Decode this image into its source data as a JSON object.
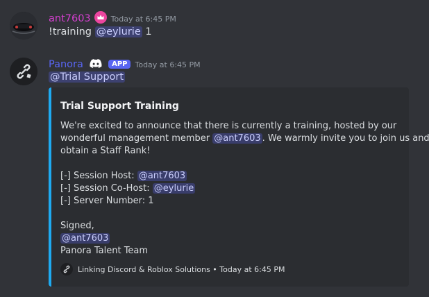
{
  "messages": [
    {
      "author": "ant7603",
      "author_color": "#d43fcf",
      "timestamp": "Today at 6:45 PM",
      "badge_icon": "crown-icon",
      "content": {
        "prefix": "!training ",
        "mention": "@eylurie",
        "suffix": " 1"
      }
    },
    {
      "author": "Panora",
      "author_color": "#5865f2",
      "app_tag": "APP",
      "badge_icon": "discord-icon",
      "timestamp": "Today at 6:45 PM",
      "mention_line": "@Trial Support",
      "embed": {
        "accent_color": "#1eaaf1",
        "title": "Trial Support Training",
        "line1": "We're excited to announce that there is currently a training, hosted by our",
        "line2_prefix": "wonderful management member ",
        "line2_mention": "@ant7603",
        "line2_suffix": ". We warmly invite you to join us and",
        "line3": "obtain a Staff Rank!",
        "host_label": "[-] Session Host: ",
        "host_mention": "@ant7603",
        "cohost_label": "[-] Session Co-Host: ",
        "cohost_mention": "@eylurie",
        "server_line": "[-] Server Number: 1",
        "signed": "Signed,",
        "signed_mention": "@ant7603",
        "team": "Panora Talent Team",
        "footer_text": "Linking Discord & Roblox Solutions",
        "footer_sep": " • ",
        "footer_time": "Today at 6:45 PM"
      }
    }
  ]
}
